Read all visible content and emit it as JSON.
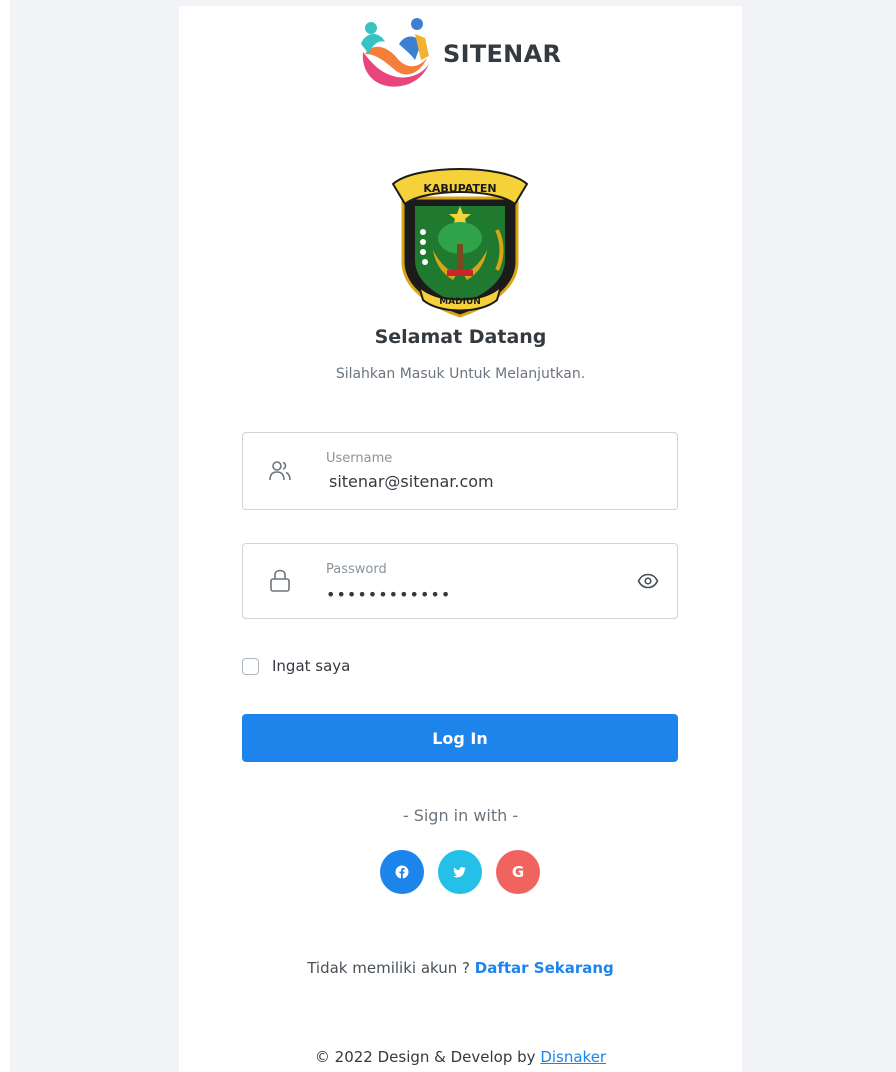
{
  "brand": {
    "name": "SITENAR",
    "logo_icon": "sitenar-logo"
  },
  "emblem": {
    "icon": "kabupaten-madiun-emblem",
    "top_text": "KABUPATEN",
    "bottom_text": "MADIUN"
  },
  "welcome": {
    "title": "Selamat Datang",
    "subtitle": "Silahkan Masuk Untuk Melanjutkan."
  },
  "form": {
    "username": {
      "label": "Username",
      "value": "sitenar@sitenar.com",
      "icon": "user-icon"
    },
    "password": {
      "label": "Password",
      "value": "••••••••••••",
      "icon": "lock-icon",
      "toggle_icon": "eye-icon"
    },
    "remember_label": "Ingat saya",
    "login_label": "Log In"
  },
  "social": {
    "heading": "- Sign in with -",
    "buttons": [
      {
        "name": "facebook",
        "icon": "facebook-icon",
        "color": "#1d84ec"
      },
      {
        "name": "twitter",
        "icon": "twitter-icon",
        "color": "#25c0e8"
      },
      {
        "name": "google",
        "icon": "google-icon",
        "label": "G",
        "color": "#f0635f"
      }
    ]
  },
  "register": {
    "text": "Tidak memiliki akun ? ",
    "link": "Daftar Sekarang"
  },
  "footer": {
    "text": "© 2022 Design & Develop by ",
    "link": "Disnaker"
  },
  "colors": {
    "primary": "#1d84ec",
    "background": "#f2f3f7",
    "card": "#ffffff"
  }
}
